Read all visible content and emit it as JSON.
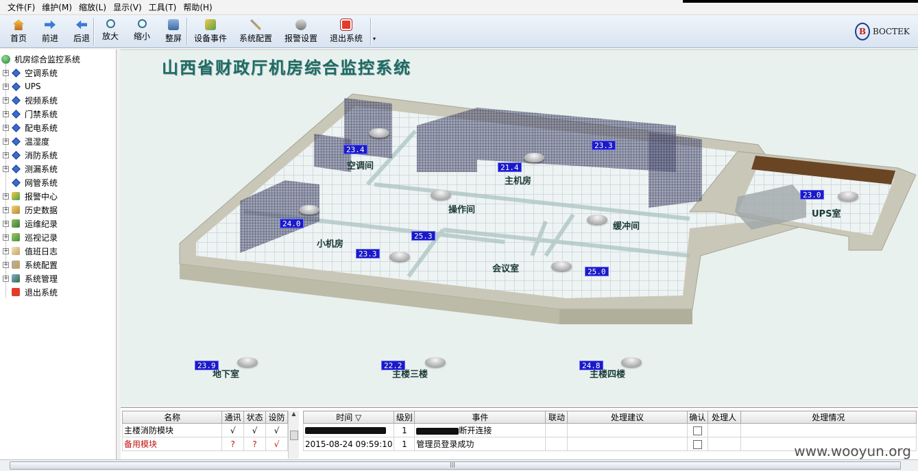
{
  "menubar": {
    "items": [
      "文件(F)",
      "维护(M)",
      "缩放(L)",
      "显示(V)",
      "工具(T)",
      "帮助(H)"
    ]
  },
  "toolbar": {
    "nav": [
      {
        "label": "首页",
        "icon": "home-icon"
      },
      {
        "label": "前进",
        "icon": "forward-arrow-icon"
      },
      {
        "label": "后退",
        "icon": "back-arrow-icon"
      }
    ],
    "zoom": [
      {
        "label": "放大",
        "icon": "zoom-in-icon"
      },
      {
        "label": "缩小",
        "icon": "zoom-out-icon"
      },
      {
        "label": "整屏",
        "icon": "fullscreen-icon"
      }
    ],
    "tools": [
      {
        "label": "设备事件",
        "icon": "device-event-icon"
      },
      {
        "label": "系统配置",
        "icon": "tools-icon"
      },
      {
        "label": "报警设置",
        "icon": "alarm-settings-icon"
      },
      {
        "label": "退出系统",
        "icon": "exit-icon"
      }
    ],
    "more": "▾"
  },
  "brand": {
    "logo_letter": "B",
    "name": "BOCTEK"
  },
  "sidebar": {
    "root": "机房综合监控系统",
    "items": [
      {
        "label": "空调系统",
        "icon": "diamond-icon"
      },
      {
        "label": "UPS",
        "icon": "diamond-icon"
      },
      {
        "label": "视频系统",
        "icon": "diamond-icon"
      },
      {
        "label": "门禁系统",
        "icon": "diamond-icon"
      },
      {
        "label": "配电系统",
        "icon": "diamond-icon"
      },
      {
        "label": "温湿度",
        "icon": "diamond-icon"
      },
      {
        "label": "消防系统",
        "icon": "diamond-icon"
      },
      {
        "label": "测漏系统",
        "icon": "diamond-icon"
      },
      {
        "label": "网管系统",
        "icon": "diamond-icon"
      },
      {
        "label": "报警中心",
        "icon": "alarm-center-icon"
      },
      {
        "label": "历史数据",
        "icon": "history-icon"
      },
      {
        "label": "运维纪录",
        "icon": "maintenance-icon"
      },
      {
        "label": "巡视记录",
        "icon": "patrol-icon"
      },
      {
        "label": "值班日志",
        "icon": "duty-log-icon"
      },
      {
        "label": "系统配置",
        "icon": "tools-icon"
      },
      {
        "label": "系统管理",
        "icon": "admin-icon"
      },
      {
        "label": "退出系统",
        "icon": "exit-icon"
      }
    ]
  },
  "main": {
    "title": "山西省财政厅机房综合监控系统",
    "rooms": {
      "ac_room": "空调间",
      "main_room": "主机房",
      "operation_room": "操作间",
      "buffer_room": "缓冲间",
      "small_room": "小机房",
      "meeting_room": "会议室",
      "ups_room": "UPS室",
      "basement": "地下室",
      "floor3": "主楼三楼",
      "floor4": "主楼四楼"
    },
    "temps": {
      "ac_room": "23.4",
      "main_room_a": "21.4",
      "main_room_b": "23.3",
      "small_room_a": "24.0",
      "small_room_b": "23.3",
      "operation": "25.3",
      "meeting": "25.0",
      "ups": "23.0",
      "basement": "23.9",
      "floor3": "22.2",
      "floor4": "24.8"
    }
  },
  "modules_table": {
    "headers": [
      "名称",
      "通讯",
      "状态",
      "设防"
    ],
    "rows": [
      {
        "name": "主楼消防模块",
        "comm": "√",
        "status": "√",
        "armed": "√",
        "alert": false
      },
      {
        "name": "备用模块",
        "comm": "?",
        "status": "?",
        "armed": "√",
        "alert": true
      }
    ]
  },
  "events_table": {
    "headers": [
      "时间",
      "级别",
      "事件",
      "联动",
      "处理建议",
      "确认",
      "处理人",
      "处理情况"
    ],
    "rows": [
      {
        "time": "",
        "level": "1",
        "event": "断开连接"
      },
      {
        "time": "2015-08-24 09:59:10",
        "level": "1",
        "event": "管理员登录成功"
      }
    ]
  },
  "watermark": "www.wooyun.org"
}
